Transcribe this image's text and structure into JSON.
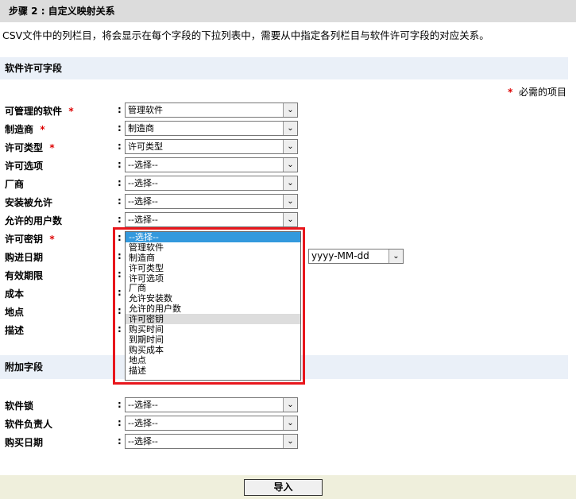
{
  "step_title": "步骤 2 : 自定义映射关系",
  "description": "CSV文件中的列栏目，将会显示在每个字段的下拉列表中，需要从中指定各列栏目与软件许可字段的对应关系。",
  "section1": "软件许可字段",
  "required_note": "必需的项目",
  "colon": ":",
  "fields": [
    {
      "label": "可管理的软件",
      "required": true,
      "value": "管理软件"
    },
    {
      "label": "制造商",
      "required": true,
      "value": "制造商"
    },
    {
      "label": "许可类型",
      "required": true,
      "value": "许可类型"
    },
    {
      "label": "许可选项",
      "required": false,
      "value": "--选择--"
    },
    {
      "label": "厂商",
      "required": false,
      "value": "--选择--"
    },
    {
      "label": "安装被允许",
      "required": false,
      "value": "--选择--"
    },
    {
      "label": "允许的用户数",
      "required": false,
      "value": "--选择--"
    },
    {
      "label": "许可密钥",
      "required": true,
      "value": "--选择--"
    },
    {
      "label": "购进日期",
      "required": false,
      "value": ""
    },
    {
      "label": "有效期限",
      "required": false,
      "value": ""
    },
    {
      "label": "成本",
      "required": false,
      "value": ""
    },
    {
      "label": "地点",
      "required": false,
      "value": ""
    },
    {
      "label": "描述",
      "required": false,
      "value": ""
    }
  ],
  "date_format": "yyyy-MM-dd",
  "dropdown_options": [
    "--选择--",
    "管理软件",
    "制造商",
    "许可类型",
    "许可选项",
    "厂商",
    "允许安装数",
    "允许的用户数",
    "许可密钥",
    "购买时间",
    "到期时间",
    "购买成本",
    "地点",
    "描述"
  ],
  "section2": "附加字段",
  "extra_fields": [
    {
      "label": "软件锁",
      "value": "--选择--"
    },
    {
      "label": "软件负责人",
      "value": "--选择--"
    },
    {
      "label": "购买日期",
      "value": "--选择--"
    }
  ],
  "import_button": "导入",
  "accent": "#e8161c"
}
